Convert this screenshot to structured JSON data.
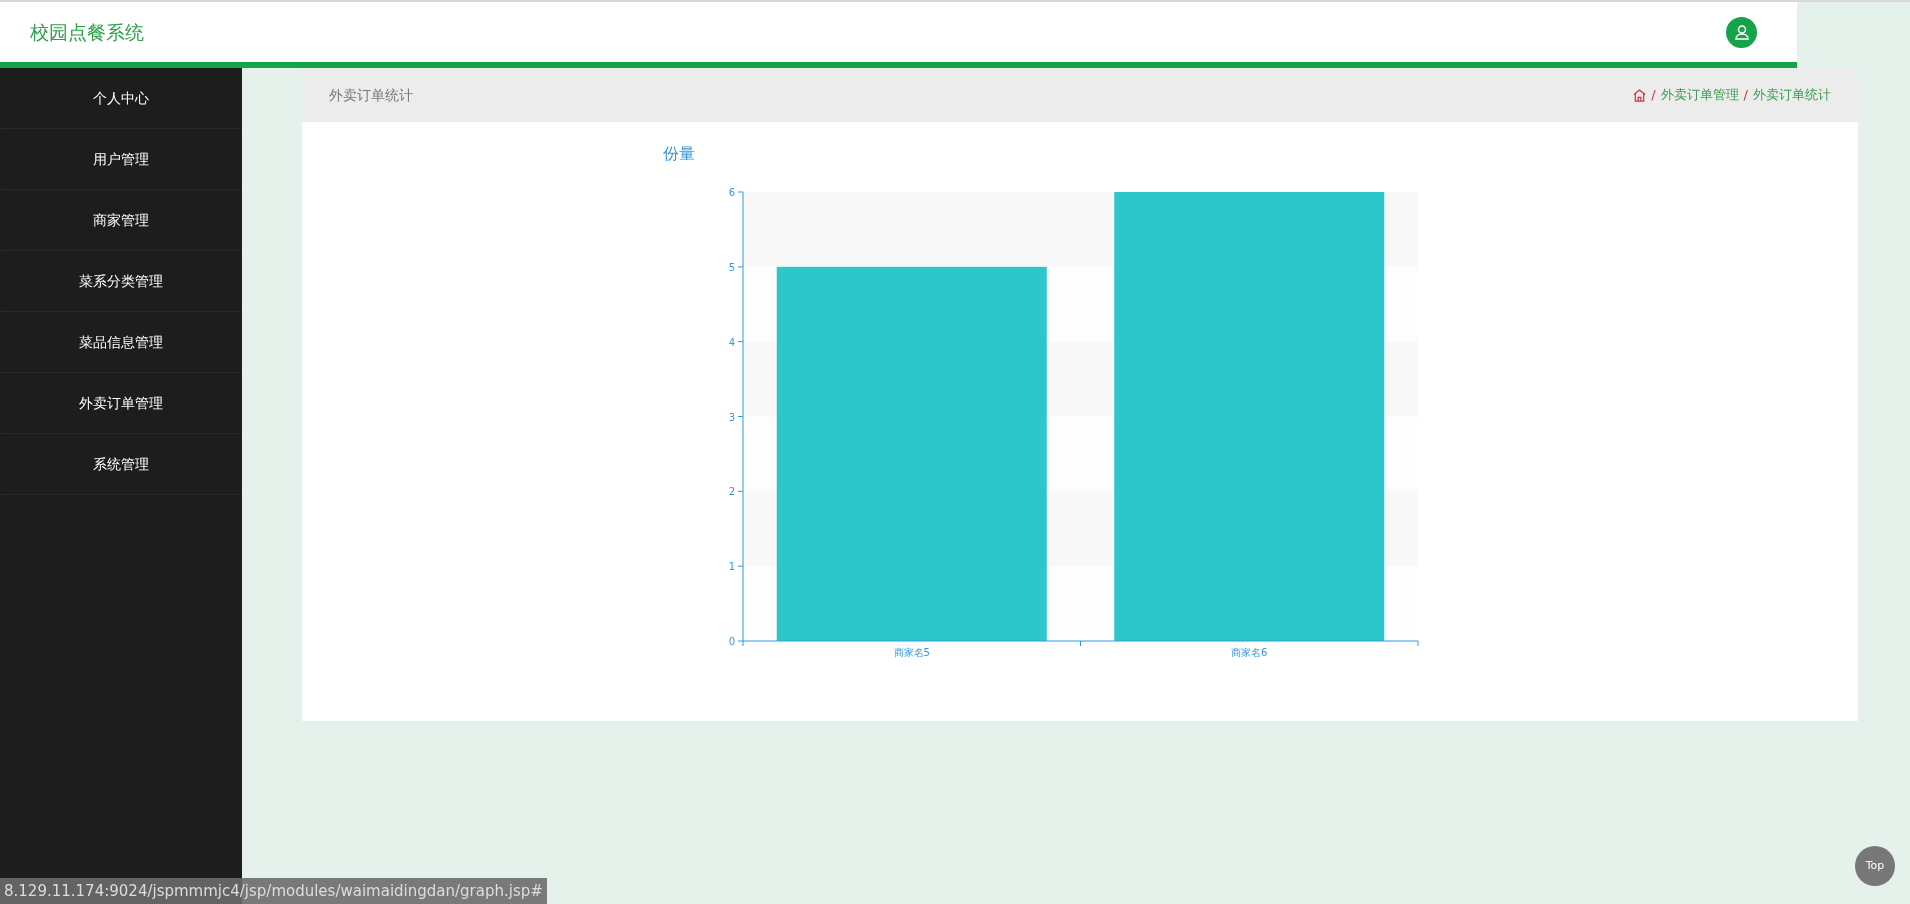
{
  "header": {
    "title": "校园点餐系统"
  },
  "sidebar": {
    "items": [
      {
        "label": "个人中心"
      },
      {
        "label": "用户管理"
      },
      {
        "label": "商家管理"
      },
      {
        "label": "菜系分类管理"
      },
      {
        "label": "菜品信息管理"
      },
      {
        "label": "外卖订单管理"
      },
      {
        "label": "系统管理"
      }
    ]
  },
  "page": {
    "title": "外卖订单统计",
    "breadcrumb": [
      {
        "separator": "/",
        "label": "外卖订单管理"
      },
      {
        "separator": "/",
        "label": "外卖订单统计"
      }
    ]
  },
  "chart": {
    "chart_data": {
      "type": "bar",
      "categories": [
        "商家名5",
        "商家名6"
      ],
      "series": [
        {
          "name": "份量",
          "color": "#2ec7c9",
          "values": [
            5,
            6
          ]
        }
      ],
      "ylim": [
        0,
        6
      ],
      "yticks": [
        0,
        1,
        2,
        3,
        4,
        5,
        6
      ]
    }
  },
  "status_bar": {
    "url": "8.129.11.174:9024/jspmmmjc4/jsp/modules/waimaidingdan/graph.jsp#"
  },
  "top_button": {
    "label": "Top"
  }
}
